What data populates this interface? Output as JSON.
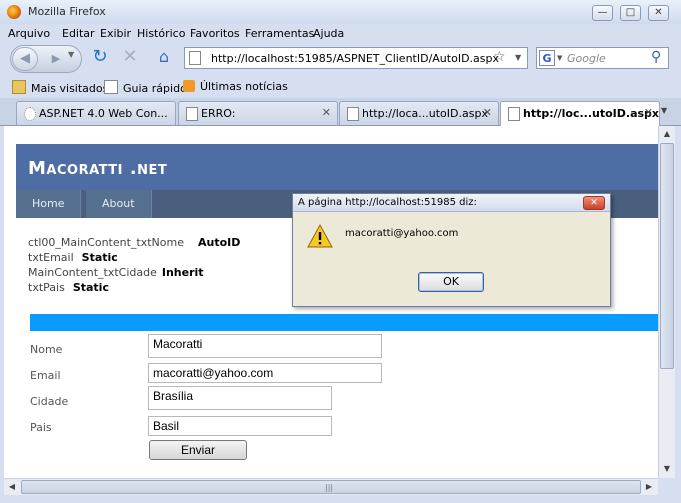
{
  "window": {
    "title": "Mozilla Firefox",
    "min_icon": "—",
    "max_icon": "□",
    "close_icon": "✕"
  },
  "menu": [
    "Arquivo",
    "Editar",
    "Exibir",
    "Histórico",
    "Favoritos",
    "Ferramentas",
    "Ajuda"
  ],
  "nav": {
    "url": "http://localhost:51985/ASPNET_ClientID/AutoID.aspx",
    "search_placeholder": "Google",
    "search_engine_letter": "G"
  },
  "bookmarks": [
    "Mais visitados",
    "Guia rápido",
    "Últimas notícias"
  ],
  "tabs": [
    {
      "label": "ASP.NET 4.0 Web Con...",
      "active": false
    },
    {
      "label": "ERRO:",
      "active": false
    },
    {
      "label": "http://loca...utoID.aspx",
      "active": false
    },
    {
      "label": "http://loc...utoID.aspx",
      "active": true
    }
  ],
  "site": {
    "title": "Macoratti .net",
    "nav": [
      "Home",
      "About"
    ],
    "info": [
      {
        "label": "ctl00_MainContent_txtNome",
        "value": "AutoID"
      },
      {
        "label": "txtEmail",
        "value": "Static"
      },
      {
        "label": "MainContent_txtCidade",
        "value": "Inherit"
      },
      {
        "label": "txtPais",
        "value": "Static"
      }
    ],
    "form": {
      "nome_label": "Nome",
      "nome_value": "Macoratti",
      "email_label": "Email",
      "email_value": "macoratti@yahoo.com",
      "cidade_label": "Cidade",
      "cidade_value": "Brasília",
      "pais_label": "Pais",
      "pais_value": "Basil",
      "submit_label": "Enviar"
    }
  },
  "dialog": {
    "title": "A página http://localhost:51985 diz:",
    "message": "macoratti@yahoo.com",
    "ok_label": "OK",
    "close_label": "✕"
  },
  "colors": {
    "header": "#4d6da4",
    "nav": "#4a5f7d",
    "accent_bar": "#0a9bff"
  }
}
